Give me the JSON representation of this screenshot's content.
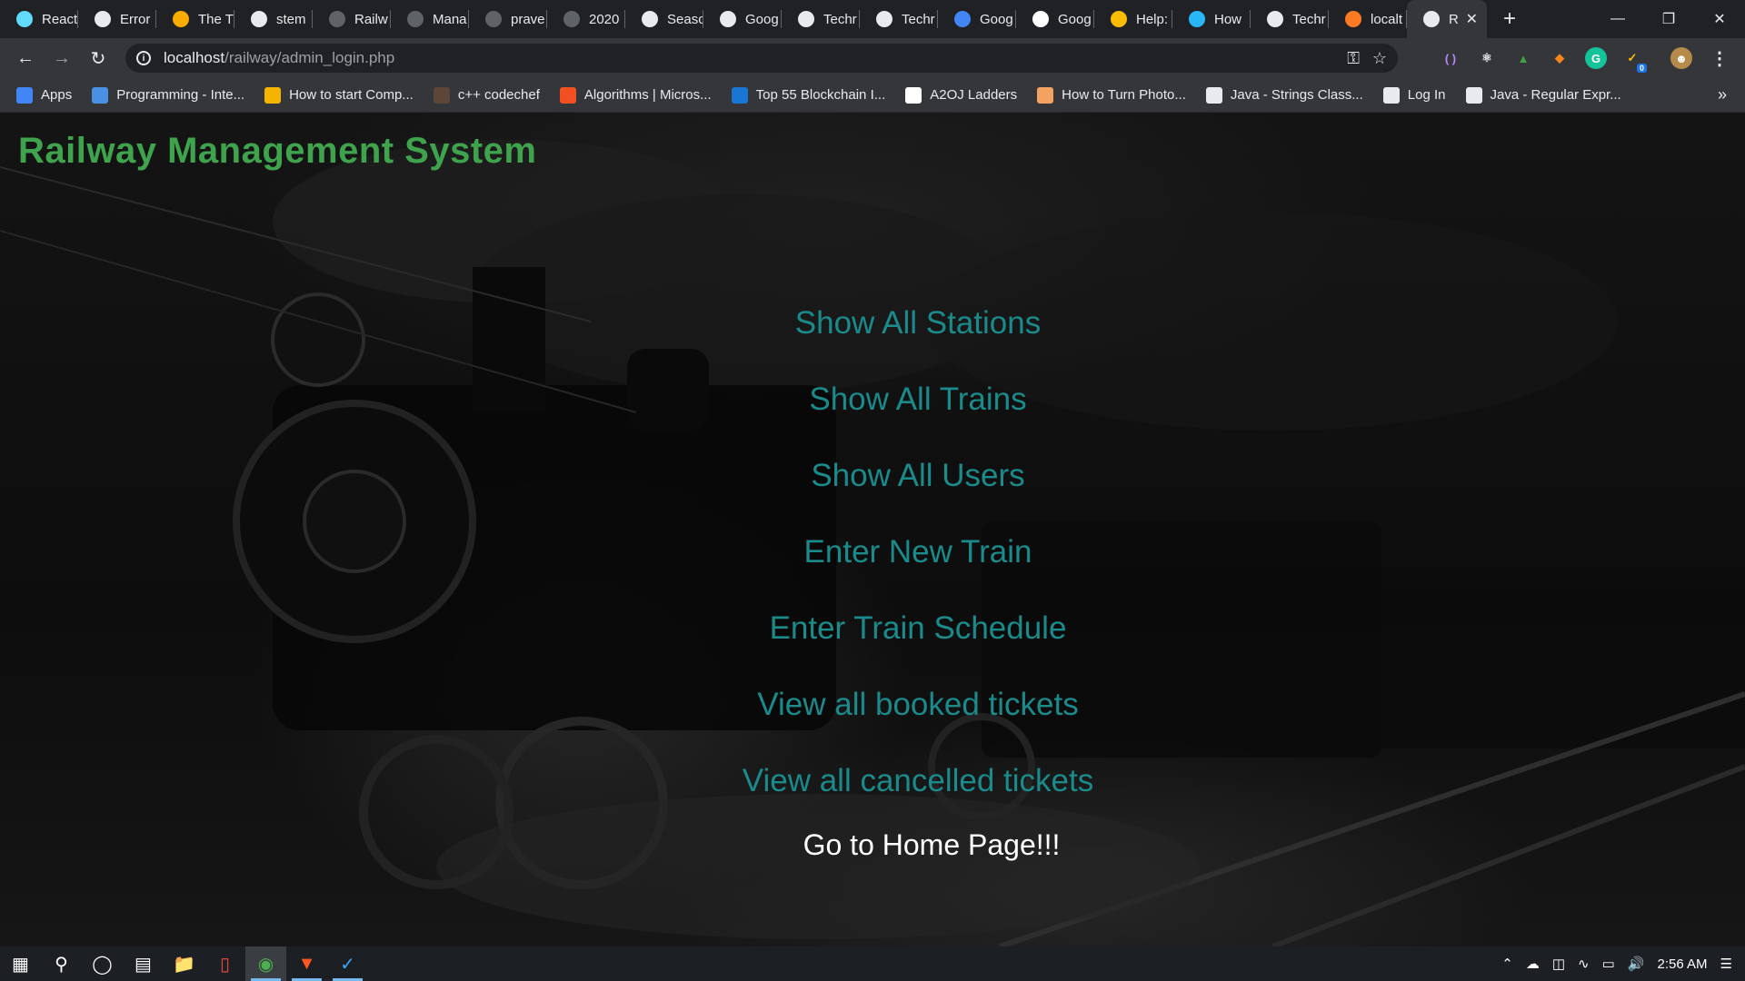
{
  "browser": {
    "tabs": [
      {
        "title": "React",
        "icon": "react-icon",
        "color": "#61dafb"
      },
      {
        "title": "Error",
        "icon": "globe-icon",
        "color": "#e8eaed"
      },
      {
        "title": "The T",
        "icon": "page-icon",
        "color": "#f9ab00"
      },
      {
        "title": "stem",
        "icon": "google-icon",
        "color": "#e8eaed"
      },
      {
        "title": "Railw",
        "icon": "github-icon",
        "color": "#5f6368"
      },
      {
        "title": "Mana",
        "icon": "github-icon",
        "color": "#5f6368"
      },
      {
        "title": "prave",
        "icon": "github-icon",
        "color": "#5f6368"
      },
      {
        "title": "2020",
        "icon": "feather-icon",
        "color": "#5f6368"
      },
      {
        "title": "Seasc",
        "icon": "code-icon",
        "color": "#e8eaed"
      },
      {
        "title": "Goog",
        "icon": "code-icon",
        "color": "#e8eaed"
      },
      {
        "title": "Techr",
        "icon": "code-icon",
        "color": "#e8eaed"
      },
      {
        "title": "Techr",
        "icon": "code-icon",
        "color": "#e8eaed"
      },
      {
        "title": "Goog",
        "icon": "docs-icon",
        "color": "#4285f4"
      },
      {
        "title": "Goog",
        "icon": "medium-icon",
        "color": "#ffffff"
      },
      {
        "title": "Help:",
        "icon": "gear-icon",
        "color": "#fbbc04"
      },
      {
        "title": "How",
        "icon": "snowflake-icon",
        "color": "#29b6f6"
      },
      {
        "title": "Techr",
        "icon": "code-icon",
        "color": "#e8eaed"
      },
      {
        "title": "localt",
        "icon": "xampp-icon",
        "color": "#fb7a24"
      },
      {
        "title": "R",
        "icon": "globe-icon",
        "color": "#e8eaed",
        "active": true
      }
    ],
    "new_tab": "+",
    "url_host": "localhost",
    "url_path": "/railway/admin_login.php",
    "extension_badge": "0"
  },
  "bookmarks": [
    {
      "label": "Apps",
      "icon": "apps-grid-icon",
      "color": "#4285f4"
    },
    {
      "label": "Programming - Inte...",
      "icon": "interviewbit-icon",
      "color": "#4a90e2"
    },
    {
      "label": "How to start Comp...",
      "icon": "bar-chart-icon",
      "color": "#f4b400"
    },
    {
      "label": "c++ codechef",
      "icon": "codechef-icon",
      "color": "#5b4638"
    },
    {
      "label": "Algorithms | Micros...",
      "icon": "microsoft-icon",
      "color": "#f25022"
    },
    {
      "label": "Top 55 Blockchain I...",
      "icon": "edureka-icon",
      "color": "#1976d2"
    },
    {
      "label": "A2OJ Ladders",
      "icon": "a2oj-icon",
      "color": "#ffffff"
    },
    {
      "label": "How to Turn Photo...",
      "icon": "wikihow-icon",
      "color": "#f4a261"
    },
    {
      "label": "Java - Strings Class...",
      "icon": "tutorialspoint-icon",
      "color": "#e8eaed"
    },
    {
      "label": "Log In",
      "icon": "globe-icon",
      "color": "#e8eaed"
    },
    {
      "label": "Java - Regular Expr...",
      "icon": "tutorialspoint-icon",
      "color": "#e8eaed"
    }
  ],
  "page": {
    "title": "Railway Management System",
    "menu": [
      "Show All Stations",
      "Show All Trains",
      "Show All Users",
      "Enter New Train",
      "Enter Train Schedule",
      "View all booked tickets",
      "View all cancelled tickets"
    ],
    "home_link": "Go to Home Page!!!",
    "title_color": "#3fa34d",
    "link_color": "#1b8a8a"
  },
  "taskbar": {
    "clock": "2:56 AM"
  }
}
